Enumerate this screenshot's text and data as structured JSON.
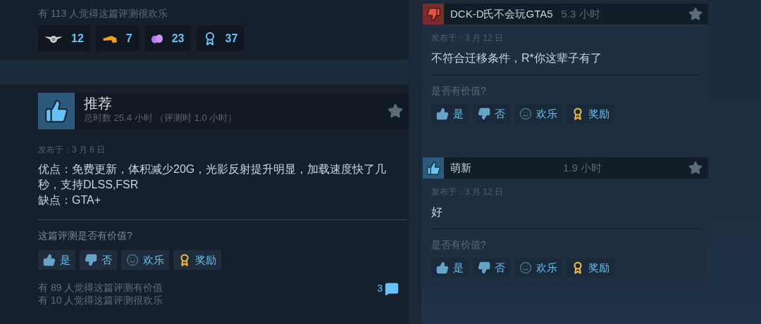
{
  "previous_review": {
    "stats": [
      "有 113 人觉得这篇评测很欢乐"
    ],
    "awards": [
      {
        "kind": "medal",
        "count": "12"
      },
      {
        "kind": "hand",
        "count": "7"
      },
      {
        "kind": "petals",
        "count": "23"
      },
      {
        "kind": "ribbon",
        "count": "37"
      }
    ]
  },
  "review": {
    "kind": "positive",
    "verdict": "推荐",
    "playtime": "总时数 25.4 小时 （评测时 1.0 小时）",
    "posted": "发布于：3 月 6 日",
    "body": [
      "优点：免费更新，体积减少20G，光影反射提升明显，加载速度快了几秒，支持DLSS,FSR",
      "缺点：GTA+"
    ],
    "prompt": "这篇评测是否有价值?",
    "buttons": [
      {
        "kind": "yes",
        "label": "是"
      },
      {
        "kind": "no",
        "label": "否"
      },
      {
        "kind": "funny",
        "label": "欢乐"
      },
      {
        "kind": "award",
        "label": "奖励"
      }
    ],
    "stats": [
      "有 89 人觉得这篇评测有价值",
      "有 10 人觉得这篇评测很欢乐"
    ],
    "comment_count": "3"
  },
  "side_reviews": [
    {
      "kind": "negative",
      "author": "DCK-D氏不会玩GTA5",
      "playtime": "5.3 小时",
      "posted": "发布于：3 月 12 日",
      "body": "不符合迁移条件，R*你这辈子有了",
      "prompt": "是否有价值?",
      "buttons": [
        {
          "kind": "yes",
          "label": "是"
        },
        {
          "kind": "no",
          "label": "否"
        },
        {
          "kind": "funny",
          "label": "欢乐"
        },
        {
          "kind": "award",
          "label": "奖励"
        }
      ]
    },
    {
      "kind": "positive",
      "author": "萌新",
      "playtime": "1.9 小时",
      "posted": "发布于：3 月 12 日",
      "body": "好",
      "prompt": "是否有价值?",
      "buttons": [
        {
          "kind": "yes",
          "label": "是"
        },
        {
          "kind": "no",
          "label": "否"
        },
        {
          "kind": "funny",
          "label": "欢乐"
        },
        {
          "kind": "award",
          "label": "奖励"
        }
      ]
    }
  ]
}
